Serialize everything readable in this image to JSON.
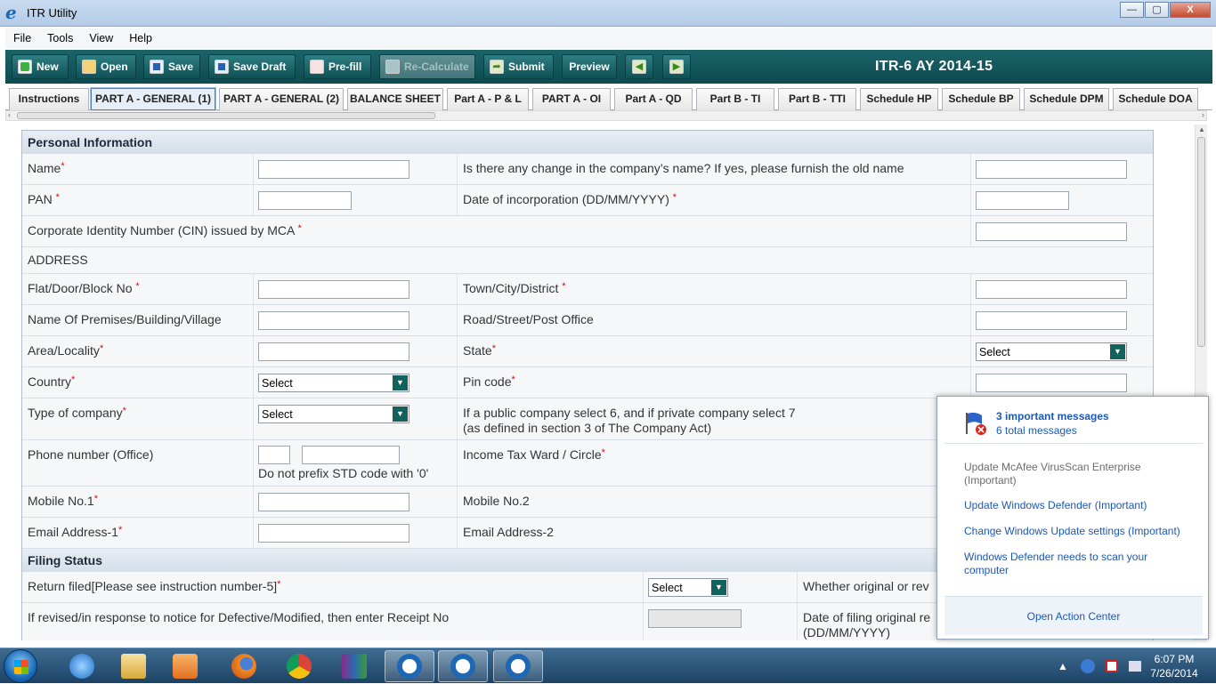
{
  "window": {
    "title": "ITR Utility",
    "app_icon": "e",
    "controls": [
      "—",
      "▢",
      "X"
    ]
  },
  "menu": [
    "File",
    "Tools",
    "View",
    "Help"
  ],
  "toolbar": {
    "buttons": [
      "New",
      "Open",
      "Save",
      "Save Draft",
      "Pre-fill",
      "Re-Calculate",
      "Submit",
      "Preview"
    ],
    "prev_icon": "◀",
    "next_icon": "▶",
    "form_title": "ITR-6   AY 2014-15"
  },
  "tabs": [
    "Instructions",
    "PART A - GENERAL (1)",
    "PART A - GENERAL (2)",
    "BALANCE SHEET",
    "Part A - P & L",
    "PART A - OI",
    "Part A - QD",
    "Part B - TI",
    "Part B - TTI",
    "Schedule HP",
    "Schedule BP",
    "Schedule DPM",
    "Schedule DOA"
  ],
  "active_tab": "PART A - GENERAL (1)",
  "personal": {
    "heading": "Personal Information",
    "name": "Name",
    "change_name": "Is there any change in the company’s name? If yes, please furnish the old name",
    "pan": "PAN ",
    "doi": "Date of incorporation (DD/MM/YYYY) ",
    "cin": "Corporate Identity Number (CIN) issued by MCA ",
    "address": "ADDRESS",
    "flat": "Flat/Door/Block No ",
    "town": "Town/City/District ",
    "premises": "Name Of Premises/Building/Village",
    "road": "Road/Street/Post Office",
    "area": "Area/Locality",
    "state": "State",
    "country": "Country",
    "pin": "Pin code",
    "type": "Type of company",
    "type_note_1": "If a public company select 6, and if private company select 7",
    "type_note_2": "(as defined in section 3 of The Company Act)",
    "phone": "Phone number (Office)",
    "phone_note": "Do not prefix STD code with '0'",
    "ward": "Income Tax Ward / Circle",
    "mobile1": "Mobile No.1",
    "mobile2": "Mobile No.2",
    "email1": "Email Address-1",
    "email2": "Email Address-2",
    "select": "Select",
    "req": "*"
  },
  "filing": {
    "heading": "Filing Status",
    "return_filed": "Return filed[Please see instruction number-5]",
    "whether_original": "Whether original or rev",
    "revised": "If revised/in response to notice for Defective/Modified, then enter Receipt No",
    "date_orig_1": "Date of filing original re",
    "date_orig_2": "(DD/MM/YYYY)",
    "select": "Select"
  },
  "notification": {
    "important": "3 important messages",
    "total": "6 total messages",
    "items": [
      "Update McAfee VirusScan Enterprise (Important)",
      "Update Windows Defender (Important)",
      "Change Windows Update settings (Important)",
      "Windows Defender needs to scan your computer"
    ],
    "footer": "Open Action Center"
  },
  "taskbar": {
    "time": "6:07 PM",
    "date": "7/26/2014"
  },
  "colors": {
    "toolbar_bg": "#0f5055",
    "link": "#1b58b8",
    "required": "#d01010"
  }
}
